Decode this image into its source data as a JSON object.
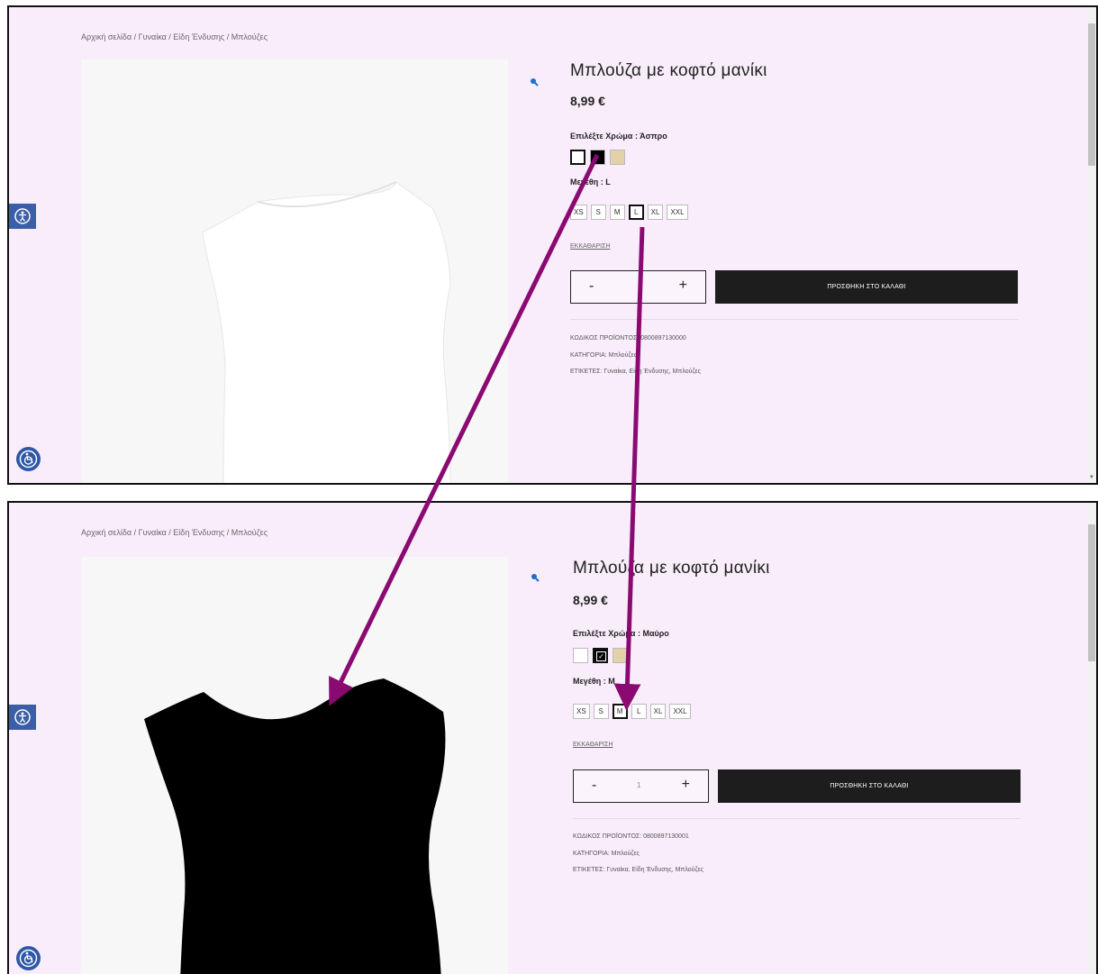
{
  "top": {
    "breadcrumb": "Αρχική σελίδα / Γυναίκα / Είδη Ένδυσης / Μπλούζες",
    "title": "Μπλούζα με κοφτό μανίκι",
    "price": "8,99 €",
    "color_label": "Επιλέξτε Χρώμα : Άσπρο",
    "size_label": "Μεγέθη : L",
    "sizes": [
      "XS",
      "S",
      "M",
      "L",
      "XL",
      "XXL"
    ],
    "selected_size": "L",
    "selected_color": "white",
    "clear": "ΕΚΚΑΘΑΡΙΣΗ",
    "qty_minus": "-",
    "qty_value": "",
    "qty_plus": "+",
    "add_to_cart": "ΠΡΟΣΘΗΚΗ ΣΤΟ ΚΑΛΑΘΙ",
    "sku": "ΚΩΔΙΚΟΣ ΠΡΟΪΟΝΤΟΣ: 0800897130000",
    "category": "ΚΑΤΗΓΟΡΙΑ: Μπλούζες",
    "tags": "ΕΤΙΚΕΤΕΣ: Γυναίκα, Είδη Ένδυσης, Μπλούζες",
    "image_color": "#ffffff"
  },
  "bottom": {
    "breadcrumb": "Αρχική σελίδα / Γυναίκα / Είδη Ένδυσης / Μπλούζες",
    "title": "Μπλούζα με κοφτό μανίκι",
    "price": "8,99 €",
    "color_label": "Επιλέξτε Χρώμα : Μαύρο",
    "size_label": "Μεγέθη : M",
    "sizes": [
      "XS",
      "S",
      "M",
      "L",
      "XL",
      "XXL"
    ],
    "selected_size": "M",
    "selected_color": "black",
    "clear": "ΕΚΚΑΘΑΡΙΣΗ",
    "qty_minus": "-",
    "qty_value": "1",
    "qty_plus": "+",
    "add_to_cart": "ΠΡΟΣΘΗΚΗ ΣΤΟ ΚΑΛΑΘΙ",
    "sku": "ΚΩΔΙΚΟΣ ΠΡΟΪΟΝΤΟΣ: 0800897130001",
    "category": "ΚΑΤΗΓΟΡΙΑ: Μπλούζες",
    "tags": "ΕΤΙΚΕΤΕΣ: Γυναίκα, Είδη Ένδυσης, Μπλούζες",
    "image_color": "#000000"
  },
  "swatch_colors": [
    "white",
    "black",
    "beige"
  ],
  "colors": {
    "panel_bg": "#f9edfb",
    "accent_arrow": "#8b0a72",
    "button_bg": "#1d1d1d",
    "accessibility_blue": "#3b5ea6"
  },
  "icons": {
    "zoom": "magnifier-icon",
    "accessibility_side": "accessibility-person-icon",
    "accessibility_bottom": "accessibility-wheelchair-icon"
  }
}
